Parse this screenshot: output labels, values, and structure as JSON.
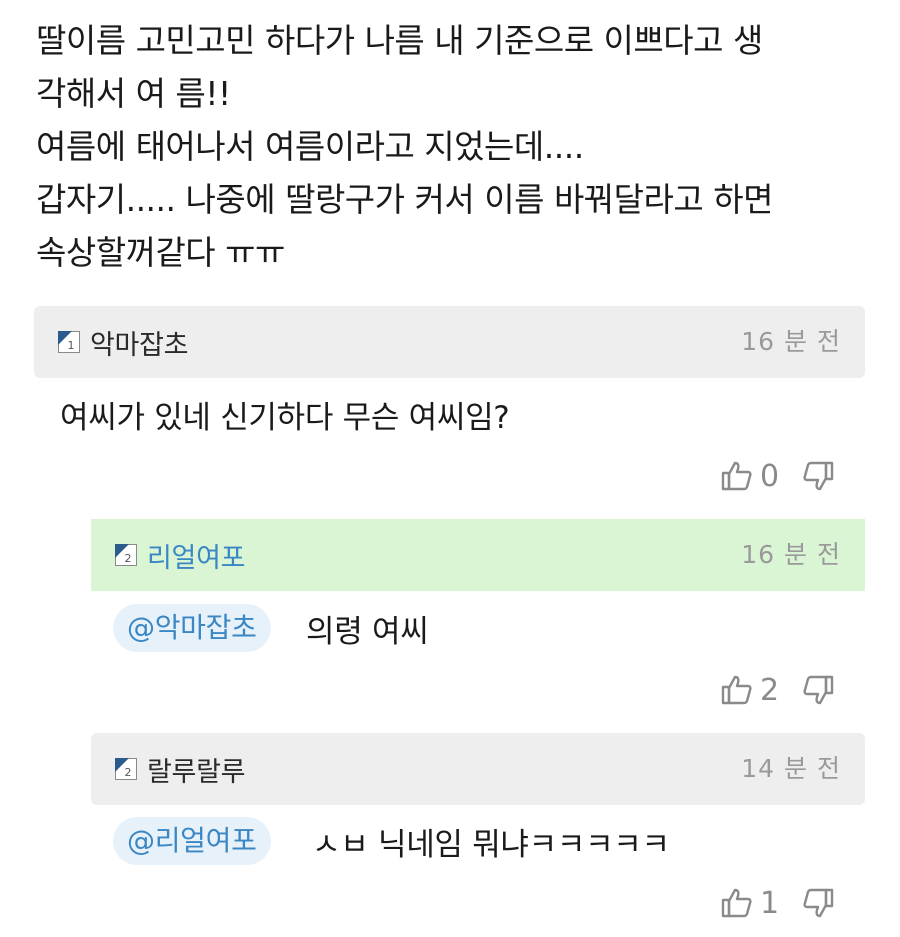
{
  "post": {
    "lines": [
      "딸이름 고민고민 하다가 나름 내 기준으로 이쁘다고 생",
      "각해서 여 름!!",
      "여름에 태어나서 여름이라고 지었는데....",
      "갑자기..... 나중에 딸랑구가 커서 이름 바꿔달라고 하면",
      "속상할꺼같다 ㅠㅠ"
    ]
  },
  "comments": [
    {
      "level": "1",
      "nickname": "악마잡초",
      "time": "16 분 전",
      "mention": "",
      "text": "여씨가 있네 신기하다 무슨 여씨임?",
      "likes": "0"
    },
    {
      "level": "2",
      "nickname": "리얼여포",
      "time": "16 분 전",
      "mention": "@악마잡초",
      "text": "의령 여씨",
      "likes": "2"
    },
    {
      "level": "2",
      "nickname": "랄루랄루",
      "time": "14 분 전",
      "mention": "@리얼여포",
      "text": "ㅅㅂ 닉네임 뭐냐ㅋㅋㅋㅋㅋ",
      "likes": "1"
    }
  ],
  "colors": {
    "header_gray": "#eeeeee",
    "header_highlight": "#d9f5d4",
    "mention_blue": "#3a87c4",
    "mention_bg": "#e7f1fa",
    "meta_gray": "#9a9a9a"
  },
  "icons": {
    "level": "level-badge-icon",
    "like": "thumbs-up-icon",
    "dislike": "thumbs-down-icon"
  }
}
